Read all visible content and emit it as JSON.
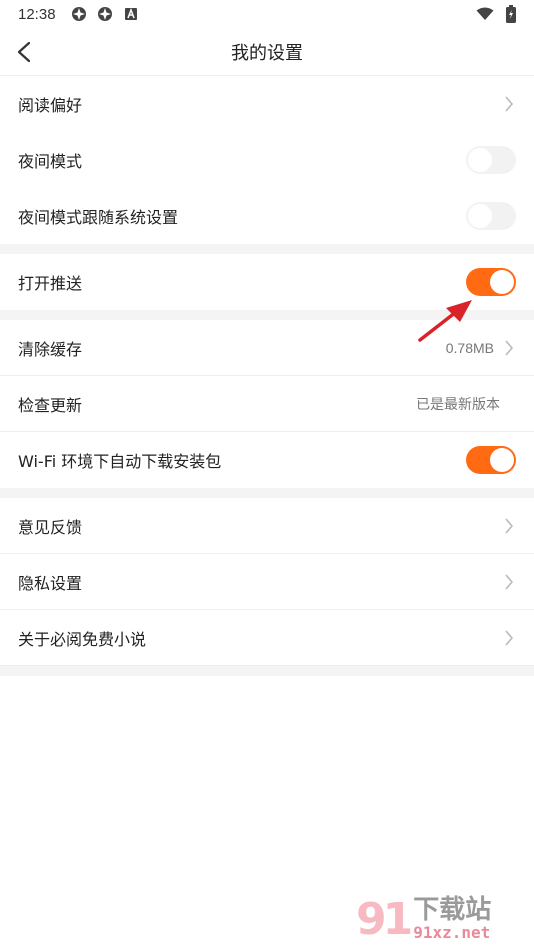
{
  "status_bar": {
    "time": "12:38"
  },
  "nav": {
    "title": "我的设置"
  },
  "section1": {
    "reading_pref": {
      "label": "阅读偏好"
    },
    "night_mode": {
      "label": "夜间模式",
      "on": false
    },
    "night_follow": {
      "label": "夜间模式跟随系统设置",
      "on": false
    }
  },
  "section2": {
    "push": {
      "label": "打开推送",
      "on": true
    }
  },
  "section3": {
    "cache": {
      "label": "清除缓存",
      "value": "0.78MB"
    },
    "update": {
      "label": "检查更新",
      "value": "已是最新版本"
    },
    "wifi_download": {
      "label": "Wi-Fi 环境下自动下载安装包",
      "on": true
    }
  },
  "section4": {
    "feedback": {
      "label": "意见反馈"
    },
    "privacy": {
      "label": "隐私设置"
    },
    "about": {
      "label": "关于必阅免费小说"
    }
  },
  "watermark": {
    "logo": "91",
    "top": "下载站",
    "bottom": "91xz.net"
  },
  "colors": {
    "accent": "#ff6a13",
    "annotation_arrow": "#d8232a"
  }
}
